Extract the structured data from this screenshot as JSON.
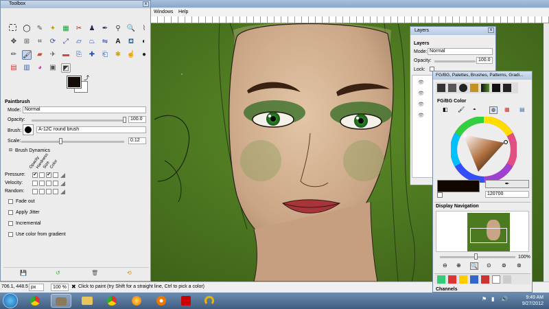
{
  "toolbox": {
    "title": "Toolbox",
    "close_glyph": "x",
    "section_title": "Paintbrush",
    "mode_label": "Mode:",
    "mode_value": "Normal",
    "opacity_label": "Opacity:",
    "opacity_value": "100.0",
    "brush_label": "Brush:",
    "brush_value": "A-12C round brush",
    "scale_label": "Scale:",
    "scale_value": "0.12",
    "dynamics_label": "Brush Dynamics",
    "dynamics_columns": [
      "Opacity",
      "Hardness",
      "Size",
      "Color"
    ],
    "dynamics_rows": [
      {
        "label": "Pressure:",
        "checked": [
          true,
          false,
          true,
          false
        ]
      },
      {
        "label": "Velocity:",
        "checked": [
          false,
          false,
          false,
          false
        ]
      },
      {
        "label": "Random:",
        "checked": [
          false,
          false,
          false,
          false
        ]
      }
    ],
    "fade_out_label": "Fade out",
    "apply_jitter_label": "Apply Jitter",
    "incremental_label": "Incremental",
    "use_color_gradient_label": "Use color from gradient"
  },
  "menubar": {
    "windows_label": "Windows",
    "help_label": "Help"
  },
  "layers_dock": {
    "title": "Layers",
    "section_title": "Layers",
    "mode_label": "Mode:",
    "mode_value": "Normal",
    "opacity_label": "Opacity:",
    "opacity_value": "100.0",
    "lock_label": "Lock:"
  },
  "fgbg_dock": {
    "title": "FG/BG, Palettes, Brushes, Patterns, Gradi...",
    "color_section_title": "FG/BG Color",
    "hex_value": "120700",
    "nav_title": "Display Navigation",
    "zoom_value": "100%",
    "channels_title": "Channels"
  },
  "statusbar": {
    "coords": "706.1, 448.5",
    "unit": "px",
    "zoom": "100 %",
    "message": "Click to paint (try Shift for a straight line, Ctrl to pick a color)"
  },
  "taskbar": {
    "time": "9:49 AM",
    "date": "9/27/2012"
  },
  "colors": {
    "foreground": "#120700",
    "background": "#ffffff",
    "canvas_green": "#4b7a21",
    "titlebar": "#a9c0da"
  }
}
